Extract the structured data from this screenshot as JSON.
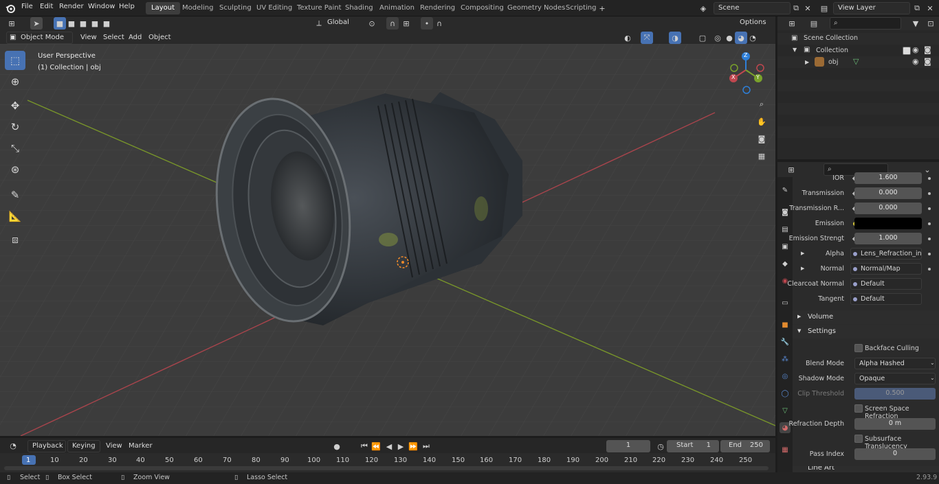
{
  "menu": {
    "items": [
      "File",
      "Edit",
      "Render",
      "Window",
      "Help"
    ]
  },
  "workspaces": [
    "Layout",
    "Modeling",
    "Sculpting",
    "UV Editing",
    "Texture Paint",
    "Shading",
    "Animation",
    "Rendering",
    "Compositing",
    "Geometry Nodes",
    "Scripting"
  ],
  "active_workspace": "Layout",
  "scene": {
    "name": "Scene",
    "view_layer": "View Layer"
  },
  "viewport_header": {
    "mode": "Object Mode",
    "menus": [
      "View",
      "Select",
      "Add",
      "Object"
    ],
    "transform_orientation": "Global",
    "options_label": "Options"
  },
  "viewport": {
    "perspective_label": "User Perspective",
    "collection_label": "(1) Collection | obj",
    "gizmo_axes": {
      "x": "X",
      "y": "Y",
      "z": "Z"
    }
  },
  "outliner": {
    "scene_collection": "Scene Collection",
    "collection": "Collection",
    "object": "obj"
  },
  "properties": {
    "rows": [
      {
        "label": "IOR",
        "value": "1.600"
      },
      {
        "label": "Transmission",
        "value": "0.000"
      },
      {
        "label": "Transmission R...",
        "value": "0.000"
      },
      {
        "label": "Emission",
        "value": ""
      },
      {
        "label": "Emission Strengt",
        "value": "1.000"
      }
    ],
    "links": [
      {
        "label": "Alpha",
        "value": "Lens_Refraction_inv..."
      },
      {
        "label": "Normal",
        "value": "Normal/Map"
      },
      {
        "label": "Clearcoat Normal",
        "value": "Default"
      },
      {
        "label": "Tangent",
        "value": "Default"
      }
    ],
    "sections": {
      "volume": "Volume",
      "settings": "Settings",
      "line_art": "Line Art"
    },
    "settings": {
      "backface_culling": "Backface Culling",
      "blend_mode_label": "Blend Mode",
      "blend_mode": "Alpha Hashed",
      "shadow_mode_label": "Shadow Mode",
      "shadow_mode": "Opaque",
      "clip_threshold_label": "Clip Threshold",
      "clip_threshold": "0.500",
      "ssr": "Screen Space Refraction",
      "refraction_depth_label": "Refraction Depth",
      "refraction_depth": "0 m",
      "subsurface": "Subsurface Translucency",
      "pass_index_label": "Pass Index",
      "pass_index": "0"
    }
  },
  "timeline": {
    "menus": [
      "Playback",
      "Keying",
      "View",
      "Marker"
    ],
    "current_frame": "1",
    "start_label": "Start",
    "start": "1",
    "end_label": "End",
    "end": "250",
    "ticks": [
      "1",
      "10",
      "20",
      "30",
      "40",
      "50",
      "60",
      "70",
      "80",
      "90",
      "100",
      "110",
      "120",
      "130",
      "140",
      "150",
      "160",
      "170",
      "180",
      "190",
      "200",
      "210",
      "220",
      "230",
      "240",
      "250"
    ]
  },
  "statusbar": {
    "select": "Select",
    "box_select": "Box Select",
    "zoom_view": "Zoom View",
    "lasso_select": "Lasso Select",
    "version": "2.93.9"
  },
  "colors": {
    "accent": "#4772b3",
    "x_axis": "#c0474f",
    "y_axis": "#7aa22b",
    "z_axis": "#2e7fd8"
  }
}
